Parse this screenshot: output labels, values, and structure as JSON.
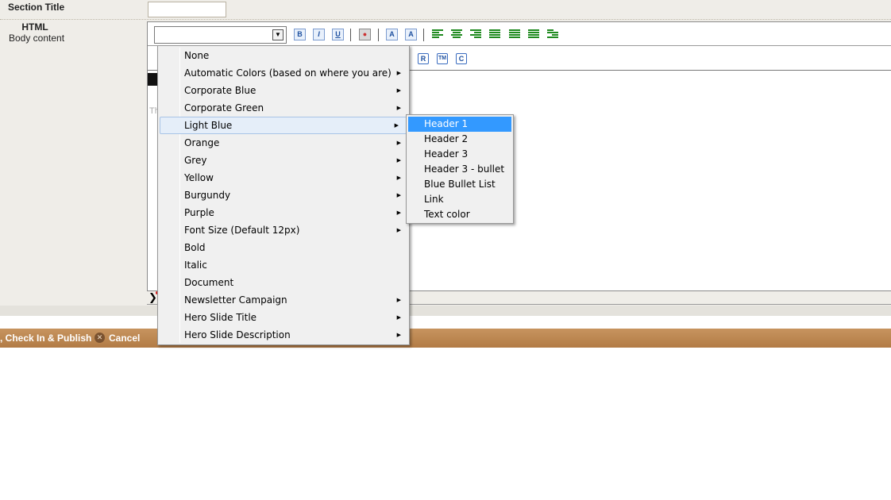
{
  "form": {
    "section_title_label": "Section Title",
    "section_title_value": "",
    "html_label": "HTML",
    "body_label": "Body content"
  },
  "editor": {
    "style_select_value": "",
    "dark_fragment": "Te",
    "grey_fragment": "Th",
    "toolbar1": {
      "bold": "B",
      "italic": "I",
      "underline": "U",
      "superscript": "A",
      "subscript": "A"
    },
    "toolbar2": {
      "registered": "R",
      "trademark": "TM",
      "copyright": "C"
    }
  },
  "actions": {
    "publish_label": ", Check In & Publish",
    "cancel_label": "Cancel"
  },
  "menu": {
    "items": [
      {
        "label": "None",
        "submenu": false
      },
      {
        "label": "Automatic Colors (based on where you are)",
        "submenu": true
      },
      {
        "label": "Corporate Blue",
        "submenu": true
      },
      {
        "label": "Corporate Green",
        "submenu": true
      },
      {
        "label": "Light Blue",
        "submenu": true,
        "highlighted": true
      },
      {
        "label": "Orange",
        "submenu": true
      },
      {
        "label": "Grey",
        "submenu": true
      },
      {
        "label": "Yellow",
        "submenu": true
      },
      {
        "label": "Burgundy",
        "submenu": true
      },
      {
        "label": "Purple",
        "submenu": true
      },
      {
        "label": "Font Size (Default 12px)",
        "submenu": true
      },
      {
        "label": "Bold",
        "submenu": false
      },
      {
        "label": "Italic",
        "submenu": false
      },
      {
        "label": "Document",
        "submenu": false
      },
      {
        "label": "Newsletter Campaign",
        "submenu": true
      },
      {
        "label": "Hero Slide Title",
        "submenu": true
      },
      {
        "label": "Hero Slide Description",
        "submenu": true
      }
    ],
    "arrow": "▶"
  },
  "submenu": {
    "items": [
      {
        "label": "Header 1",
        "selected": true
      },
      {
        "label": "Header 2"
      },
      {
        "label": "Header 3"
      },
      {
        "label": "Header 3 - bullet"
      },
      {
        "label": "Blue Bullet List"
      },
      {
        "label": "Link"
      },
      {
        "label": "Text color"
      }
    ]
  },
  "colors": {
    "action_bar": "#b98450",
    "menu_highlight": "#e5eef9",
    "submenu_selected": "#3399ff"
  }
}
